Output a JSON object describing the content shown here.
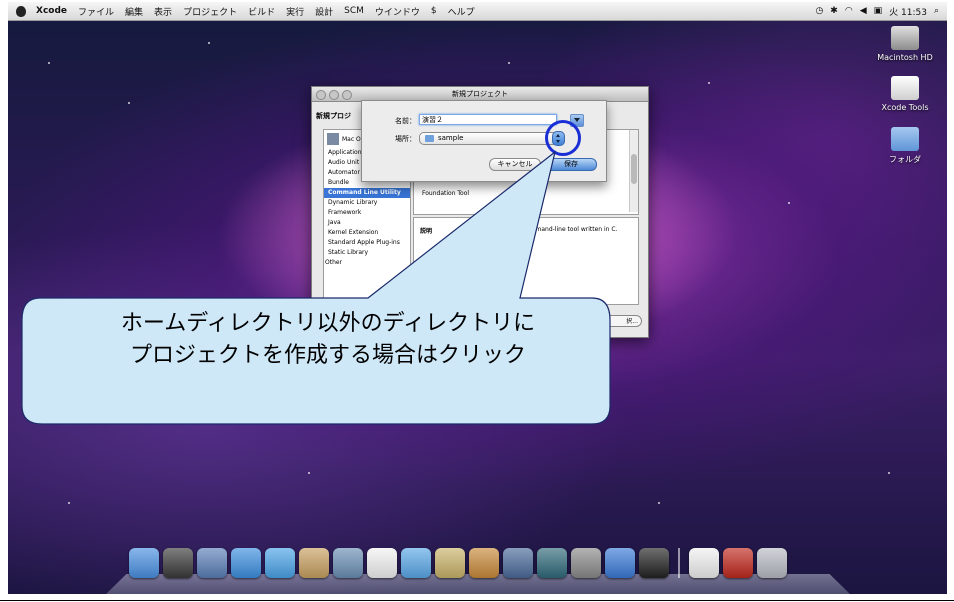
{
  "menubar": {
    "app": "Xcode",
    "items": [
      "ファイル",
      "編集",
      "表示",
      "プロジェクト",
      "ビルド",
      "実行",
      "設計",
      "SCM",
      "ウインドウ",
      "ヘルプ"
    ],
    "clock": "火 11:53"
  },
  "desktop": {
    "icons": [
      {
        "label": "Macintosh HD"
      },
      {
        "label": "Xcode Tools"
      },
      {
        "label": "フォルダ"
      }
    ]
  },
  "window": {
    "title": "新規プロジェクト",
    "heading": "新規プロジ",
    "category_header": "Mac O",
    "categories": [
      {
        "label": "Application"
      },
      {
        "label": "Audio Unit"
      },
      {
        "label": "Automator"
      },
      {
        "label": "Bundle"
      },
      {
        "label": "Command Line Utility"
      },
      {
        "label": "Dynamic Library"
      },
      {
        "label": "Framework"
      },
      {
        "label": "Java"
      },
      {
        "label": "Kernel Extension"
      },
      {
        "label": "Standard Apple Plug-ins"
      },
      {
        "label": "Static Library"
      },
      {
        "label": "Other"
      }
    ],
    "selected_category": "Command Line Utility",
    "template_partial": "s",
    "template_item": "Foundation Tool",
    "description_label": "説明",
    "description_text": "ommand-line tool written in C.",
    "partial_button": "択..."
  },
  "sheet": {
    "name_label": "名前：",
    "name_value": "演習２",
    "location_label": "場所：",
    "location_value": "sample",
    "cancel_label": "キャンセル",
    "save_label": "保存"
  },
  "callout": {
    "line1": "ホームディレクトリ以外のディレクトリに",
    "line2": "プロジェクトを作成する場合はクリック"
  },
  "dock": {
    "items": [
      {
        "name": "finder-icon",
        "color": "#4a90e2"
      },
      {
        "name": "dashboard-icon",
        "color": "#3a3a3a"
      },
      {
        "name": "mail-icon",
        "color": "#5a7fb8"
      },
      {
        "name": "safari-icon",
        "color": "#3c8fe0"
      },
      {
        "name": "ichat-icon",
        "color": "#4aa3e8"
      },
      {
        "name": "address-book-icon",
        "color": "#c8a060"
      },
      {
        "name": "iphoto-icon",
        "color": "#6a8fb5"
      },
      {
        "name": "ical-icon",
        "color": "#f2f2f2"
      },
      {
        "name": "itunes-icon",
        "color": "#5aa8e8"
      },
      {
        "name": "imovie-icon",
        "color": "#c9b46a"
      },
      {
        "name": "garageband-icon",
        "color": "#c88a3a"
      },
      {
        "name": "spaces-icon",
        "color": "#4a6a9a"
      },
      {
        "name": "time-machine-icon",
        "color": "#2f6a7a"
      },
      {
        "name": "system-preferences-icon",
        "color": "#8a8a8a"
      },
      {
        "name": "xcode-icon",
        "color": "#3a7ad8"
      },
      {
        "name": "terminal-icon",
        "color": "#222222"
      }
    ],
    "right_items": [
      {
        "name": "document-icon",
        "color": "#f0f0f0"
      },
      {
        "name": "filezilla-icon",
        "color": "#c0281e"
      },
      {
        "name": "trash-icon",
        "color": "#b8bcc4"
      }
    ]
  }
}
